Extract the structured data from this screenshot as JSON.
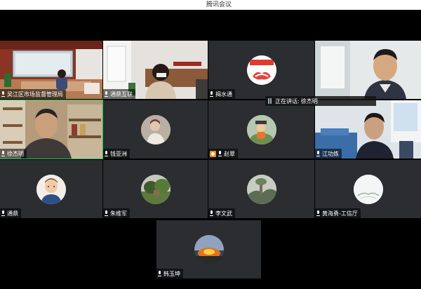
{
  "window": {
    "title": "腾讯会议"
  },
  "speaking": {
    "label": "正在讲话:",
    "name": "徐杰明"
  },
  "participants": [
    {
      "name": "吴江区市场监督管理局",
      "icon": "microphone-icon",
      "video": true
    },
    {
      "name": "通鼎互联",
      "icon": "microphone-icon",
      "video": true
    },
    {
      "name": "揭水通",
      "icon": "microphone-icon",
      "video": false
    },
    {
      "name": "",
      "icon": "",
      "video": true
    },
    {
      "name": "徐杰明",
      "icon": "microphone-icon",
      "video": true,
      "active": true
    },
    {
      "name": "钱亚洲",
      "icon": "microphone-icon",
      "video": false
    },
    {
      "name": "赵翠",
      "icon": "camera-off-icon",
      "video": false
    },
    {
      "name": "江功炼",
      "icon": "microphone-icon",
      "video": true
    },
    {
      "name": "通鼎",
      "icon": "microphone-icon",
      "video": false
    },
    {
      "name": "朱维军",
      "icon": "microphone-icon",
      "video": false
    },
    {
      "name": "李文武",
      "icon": "microphone-icon",
      "video": false
    },
    {
      "name": "黄海勇-工信厅",
      "icon": "microphone-icon",
      "video": false
    },
    {
      "name": "韩玉坤",
      "icon": "microphone-icon",
      "video": false
    }
  ],
  "colors": {
    "tile_bg": "#2b2d31",
    "active_border": "#19c35d",
    "camera_off_badge": "#f08a24"
  }
}
